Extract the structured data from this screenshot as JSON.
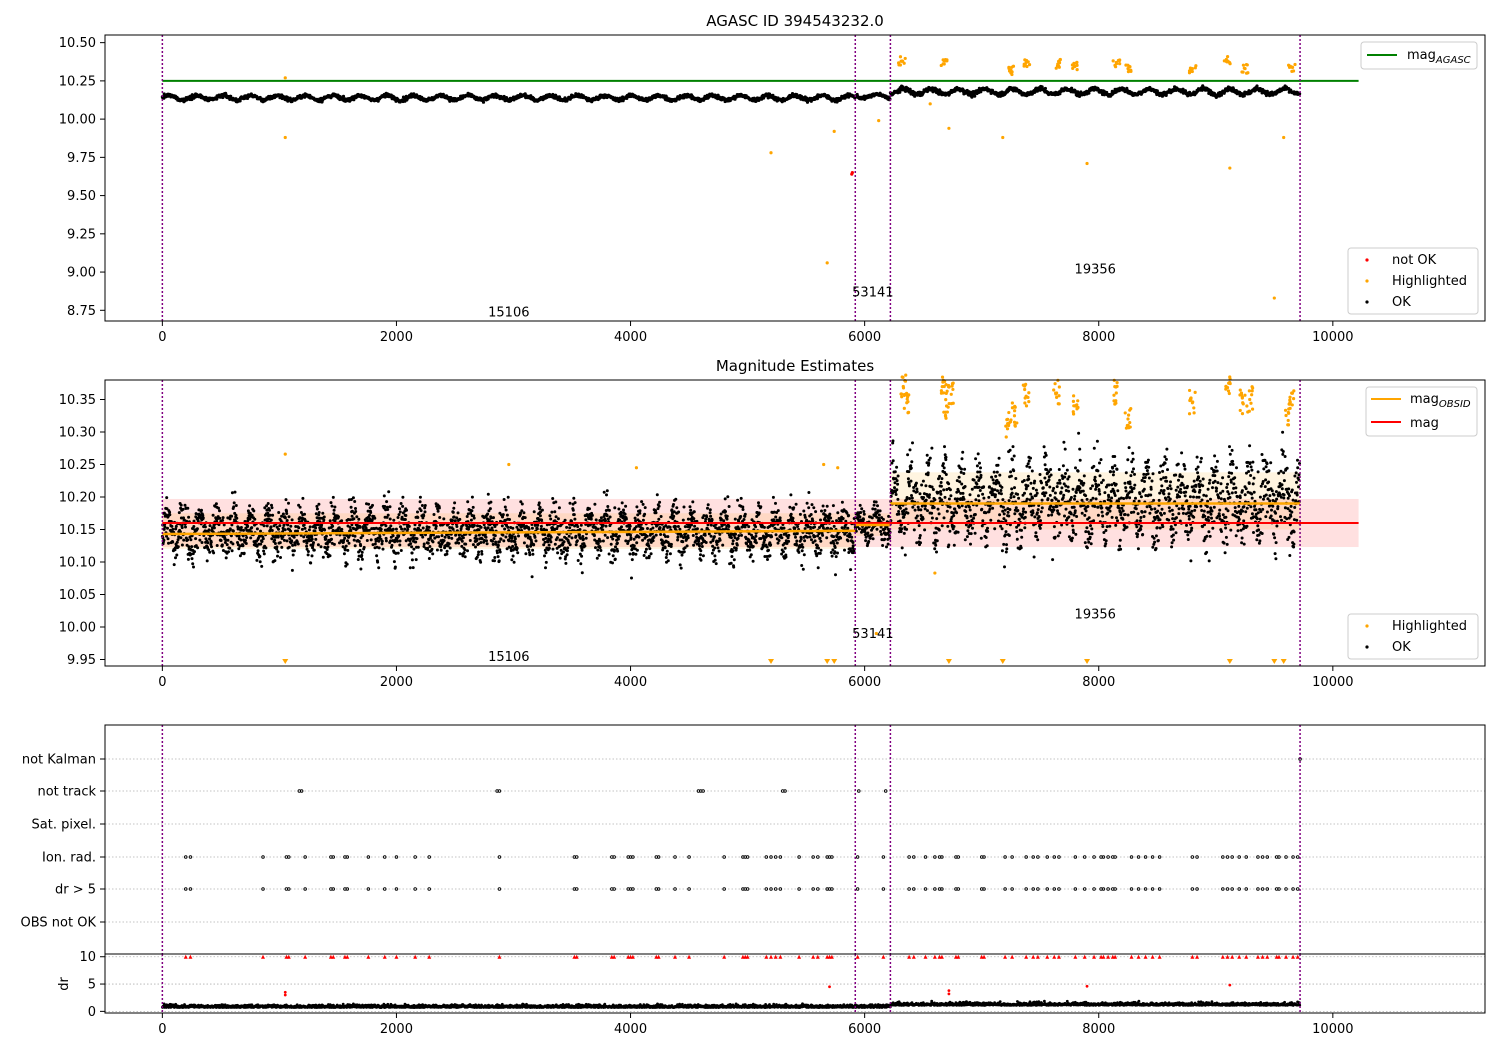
{
  "chart_data": [
    {
      "type": "scatter",
      "title": "AGASC ID 394543232.0",
      "xlabel": "",
      "ylabel": "",
      "xlim": [
        -490,
        11300
      ],
      "ylim": [
        8.68,
        10.55
      ],
      "xticks": [
        0,
        2000,
        4000,
        6000,
        8000,
        10000
      ],
      "yticks": [
        8.75,
        9.0,
        9.25,
        9.5,
        9.75,
        10.0,
        10.25,
        10.5
      ],
      "ytick_labels": [
        "8.75",
        "9.00",
        "9.25",
        "9.50",
        "9.75",
        "10.00",
        "10.25",
        "10.50"
      ],
      "mag_agasc_line": {
        "label_main": "mag",
        "label_sub": "AGASC",
        "y": 10.25,
        "x_range": [
          0,
          10220
        ],
        "color": "#008000"
      },
      "obsid_boundaries": [
        0,
        5920,
        6220,
        9720
      ],
      "obsid_labels": [
        {
          "text": "15106",
          "x": 2960,
          "y": 8.74
        },
        {
          "text": "53141",
          "x": 6070,
          "y": 8.87
        },
        {
          "text": "19356",
          "x": 7970,
          "y": 9.02
        }
      ],
      "ok_series": {
        "name": "OK",
        "color": "#000000",
        "baseline_segments": [
          {
            "x0": 0,
            "x1": 5920,
            "level": 10.14,
            "amp": 0.025
          },
          {
            "x0": 5920,
            "x1": 6220,
            "level": 10.15,
            "amp": 0.02
          },
          {
            "x0": 6220,
            "x1": 9720,
            "level": 10.18,
            "amp": 0.03
          }
        ]
      },
      "highlighted_points": {
        "name": "Highlighted",
        "color": "#ffa500",
        "x": [
          1050,
          1050,
          5200,
          5680,
          5740,
          6120,
          6320,
          6560,
          6680,
          6720,
          7180,
          7250,
          7380,
          7650,
          7790,
          7900,
          8150,
          8250,
          8800,
          9100,
          9120,
          9250,
          9500,
          9580,
          9650
        ],
        "y": [
          10.27,
          9.88,
          9.78,
          9.06,
          9.92,
          9.99,
          10.38,
          10.1,
          10.36,
          9.94,
          9.88,
          10.32,
          10.37,
          10.36,
          10.35,
          9.71,
          10.37,
          10.33,
          10.33,
          10.38,
          9.68,
          10.33,
          8.83,
          9.88,
          10.34
        ]
      },
      "not_ok_points": {
        "name": "not OK",
        "color": "#ff0000",
        "x": [
          5890,
          5895
        ],
        "y": [
          9.64,
          9.65
        ]
      },
      "legend_upper": {
        "position": "upper-right"
      },
      "legend_lower": {
        "position": "lower-right",
        "items": [
          "not OK",
          "Highlighted",
          "OK"
        ]
      }
    },
    {
      "type": "scatter",
      "title": "Magnitude Estimates",
      "xlabel": "",
      "ylabel": "",
      "xlim": [
        -490,
        11300
      ],
      "ylim": [
        9.94,
        10.38
      ],
      "xticks": [
        0,
        2000,
        4000,
        6000,
        8000,
        10000
      ],
      "yticks": [
        9.95,
        10.0,
        10.05,
        10.1,
        10.15,
        10.2,
        10.25,
        10.3,
        10.35
      ],
      "ytick_labels": [
        "9.95",
        "10.00",
        "10.05",
        "10.10",
        "10.15",
        "10.20",
        "10.25",
        "10.30",
        "10.35"
      ],
      "mag_line": {
        "label": "mag",
        "y": 10.16,
        "band": [
          10.123,
          10.197
        ],
        "x_range": [
          0,
          10220
        ],
        "color": "#ff0000"
      },
      "mag_obsid_lines": {
        "label_main": "mag",
        "label_sub": "OBSID",
        "color": "#ffa500",
        "segments": [
          {
            "x0": 0,
            "x1": 5920,
            "y0": 10.143,
            "y1": 10.148,
            "band": [
              10.12,
              10.175
            ]
          },
          {
            "x0": 5920,
            "x1": 6220,
            "y0": 10.157,
            "y1": 10.157,
            "band": [
              10.14,
              10.175
            ]
          },
          {
            "x0": 6220,
            "x1": 9720,
            "y0": 10.19,
            "y1": 10.19,
            "band": [
              10.15,
              10.238
            ]
          }
        ]
      },
      "obsid_boundaries": [
        0,
        5920,
        6220,
        9720
      ],
      "obsid_labels": [
        {
          "text": "15106",
          "x": 2960,
          "y": 9.955
        },
        {
          "text": "53141",
          "x": 6070,
          "y": 9.99
        },
        {
          "text": "19356",
          "x": 7970,
          "y": 10.02
        }
      ],
      "ok_series": {
        "name": "OK",
        "color": "#000000"
      },
      "highlighted_points": {
        "name": "Highlighted",
        "color": "#ffa500",
        "x": [
          1050,
          2960,
          4050,
          5650,
          5770,
          6100,
          6330,
          6360,
          6600,
          6680,
          6700,
          6740,
          7230,
          7280,
          7380,
          7640,
          7800,
          8150,
          8250,
          8800,
          9110,
          9230,
          9290,
          9620,
          9650
        ],
        "y": [
          10.266,
          10.25,
          10.245,
          10.25,
          10.245,
          9.99,
          10.37,
          10.345,
          10.083,
          10.37,
          10.34,
          10.358,
          10.31,
          10.325,
          10.355,
          10.36,
          10.34,
          10.36,
          10.32,
          10.345,
          10.375,
          10.345,
          10.35,
          10.33,
          10.36
        ]
      },
      "offscale_low_markers": {
        "color": "#ffa500",
        "x": [
          1050,
          5200,
          5680,
          5740,
          6720,
          7180,
          7900,
          9120,
          9500,
          9580
        ]
      },
      "legend_upper": {
        "position": "upper-right"
      },
      "legend_lower": {
        "position": "lower-right",
        "items": [
          "Highlighted",
          "OK"
        ]
      }
    },
    {
      "type": "scatter",
      "title": "",
      "xlabel": "",
      "ylabel": "",
      "xlim": [
        -490,
        11300
      ],
      "category_labels": [
        "not Kalman",
        "not track",
        "Sat. pixel.",
        "Ion. rad.",
        "dr > 5",
        "OBS not OK"
      ],
      "not_track_x": [
        1170,
        1190,
        2860,
        2880,
        4580,
        4600,
        4620,
        5300,
        5320,
        5950,
        6180
      ],
      "ion_rad_x": [
        200,
        240,
        860,
        1060,
        1080,
        1220,
        1440,
        1460,
        1560,
        1580,
        1760,
        1900,
        2000,
        2160,
        2280,
        2880,
        3520,
        3540,
        3840,
        3860,
        3980,
        4000,
        4020,
        4220,
        4240,
        4380,
        4500,
        4800,
        4960,
        4980,
        5000,
        5160,
        5200,
        5240,
        5280,
        5440,
        5560,
        5600,
        5680,
        5700,
        5720,
        5940,
        6160,
        6380,
        6420,
        6520,
        6600,
        6640,
        6660,
        6780,
        6800,
        7000,
        7020,
        7200,
        7260,
        7380,
        7440,
        7480,
        7560,
        7620,
        7660,
        7800,
        7880,
        7960,
        8020,
        8040,
        8080,
        8120,
        8140,
        8280,
        8340,
        8400,
        8460,
        8520,
        8800,
        8840,
        9060,
        9100,
        9140,
        9200,
        9260,
        9360,
        9400,
        9440,
        9520,
        9540,
        9600,
        9660,
        9700
      ],
      "dr_gt5_x": [
        200,
        240,
        860,
        1060,
        1080,
        1220,
        1440,
        1460,
        1560,
        1580,
        1760,
        1900,
        2000,
        2160,
        2280,
        2880,
        3520,
        3540,
        3840,
        3860,
        3980,
        4000,
        4020,
        4220,
        4240,
        4380,
        4500,
        4800,
        4960,
        4980,
        5000,
        5160,
        5200,
        5240,
        5280,
        5440,
        5560,
        5600,
        5680,
        5700,
        5720,
        5940,
        6160,
        6380,
        6420,
        6520,
        6600,
        6640,
        6660,
        6780,
        6800,
        7000,
        7020,
        7200,
        7260,
        7380,
        7440,
        7480,
        7560,
        7620,
        7660,
        7800,
        7880,
        7960,
        8020,
        8040,
        8080,
        8120,
        8140,
        8280,
        8340,
        8400,
        8460,
        8520,
        8800,
        8840,
        9060,
        9100,
        9140,
        9200,
        9260,
        9360,
        9400,
        9440,
        9520,
        9540,
        9600,
        9660,
        9700
      ],
      "not_kalman_x": [
        9720
      ],
      "obsid_boundaries": [
        0,
        5920,
        6220,
        9720
      ]
    },
    {
      "type": "scatter",
      "title": "",
      "xlabel": "",
      "ylabel": "dr",
      "xlim": [
        -490,
        11300
      ],
      "ylim": [
        -0.3,
        10.5
      ],
      "xticks": [
        0,
        2000,
        4000,
        6000,
        8000,
        10000
      ],
      "yticks": [
        0,
        5,
        10
      ],
      "dr_gt5_clipped": {
        "color": "#ff0000",
        "y": 10
      },
      "outliers": {
        "color": "#ff0000",
        "x": [
          1050,
          1050,
          5700,
          6720,
          6720,
          7900,
          9120
        ],
        "y": [
          3.0,
          3.5,
          4.5,
          3.8,
          3.2,
          4.6,
          4.8
        ]
      },
      "obsid_boundaries": [
        0,
        5920,
        6220,
        9720
      ]
    }
  ]
}
